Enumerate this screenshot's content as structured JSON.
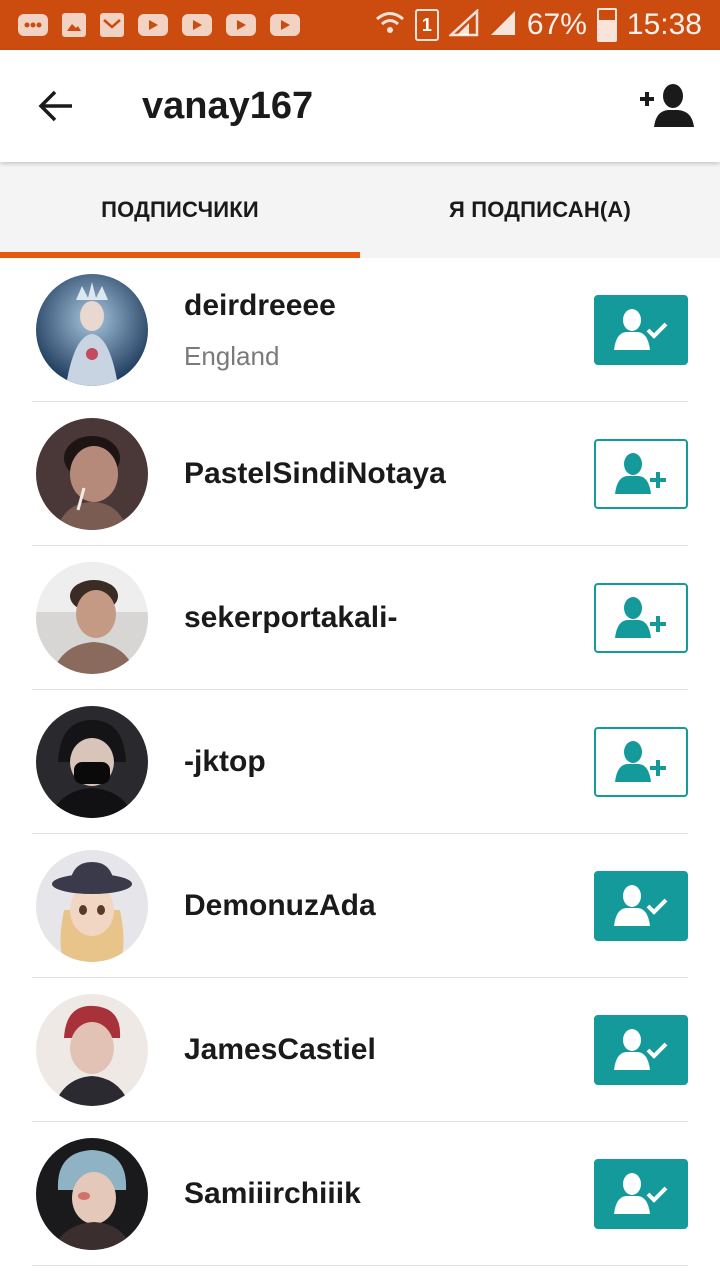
{
  "status_bar": {
    "battery": "67%",
    "time": "15:38",
    "sim_slot": "1",
    "icons": [
      "messenger-icon",
      "gallery-icon",
      "gmail-icon",
      "youtube-icon",
      "youtube-icon",
      "youtube-icon",
      "youtube-icon",
      "wifi-icon",
      "signal-icon",
      "signal-icon",
      "battery-icon"
    ]
  },
  "header": {
    "title": "vanay167",
    "back_icon": "arrow-left-icon",
    "add_icon": "add-user-icon"
  },
  "tabs": [
    {
      "label": "ПОДПИСЧИКИ",
      "active": true
    },
    {
      "label": "Я ПОДПИСАН(А)",
      "active": false
    }
  ],
  "users": [
    {
      "name": "deirdreeee",
      "location": "England",
      "following": true
    },
    {
      "name": "PastelSindiNotaya",
      "location": "",
      "following": false
    },
    {
      "name": "sekerportakali-",
      "location": "",
      "following": false
    },
    {
      "name": "-jktop",
      "location": "",
      "following": false
    },
    {
      "name": "DemonuzAda",
      "location": "",
      "following": true
    },
    {
      "name": "JamesCastiel",
      "location": "",
      "following": true
    },
    {
      "name": "Samiiirchiiik",
      "location": "",
      "following": true
    }
  ],
  "colors": {
    "status_bar": "#cc4b0e",
    "tab_indicator": "#e8580f",
    "teal": "#159a9c"
  }
}
